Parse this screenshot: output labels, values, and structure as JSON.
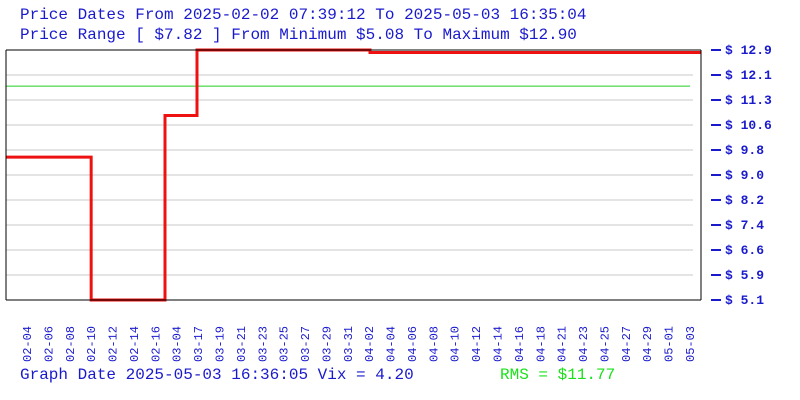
{
  "header": {
    "line1": "Price Dates From 2025-02-02 07:39:12 To 2025-05-03 16:35:04",
    "line2": "Price Range [ $7.82 ] From Minimum $5.08 To Maximum $12.90"
  },
  "footer": {
    "graph_date": "Graph Date 2025-05-03 16:36:05 Vix = 4.20",
    "rms": "RMS = $11.77"
  },
  "colors": {
    "price_line": "#ee1111",
    "rms_line": "#22cc22",
    "text": "#1a1acd",
    "grid": "#c8c8c8"
  },
  "chart_data": {
    "type": "line",
    "line_shape": "step",
    "ylim": [
      5.08,
      12.9
    ],
    "y_ticks": [
      "$ 12.9",
      "$ 12.1",
      "$ 11.3",
      "$ 10.6",
      "$ 9.8",
      "$ 9.0",
      "$ 8.2",
      "$ 7.4",
      "$ 6.6",
      "$ 5.9",
      "$ 5.1"
    ],
    "x_ticks": [
      "02-04",
      "02-06",
      "02-08",
      "02-10",
      "02-12",
      "02-14",
      "02-16",
      "03-04",
      "03-17",
      "03-19",
      "03-21",
      "03-23",
      "03-25",
      "03-27",
      "03-29",
      "03-31",
      "04-02",
      "04-04",
      "04-06",
      "04-08",
      "04-10",
      "04-12",
      "04-14",
      "04-16",
      "04-18",
      "04-21",
      "04-23",
      "04-25",
      "04-27",
      "04-29",
      "05-01",
      "05-03"
    ],
    "grid": true,
    "rms": 11.77,
    "series": [
      {
        "x": [
          "02-02",
          "02-10",
          "02-17",
          "03-17",
          "04-02",
          "05-03"
        ],
        "y": [
          9.55,
          5.08,
          10.85,
          12.9,
          12.82,
          12.82
        ]
      }
    ]
  }
}
